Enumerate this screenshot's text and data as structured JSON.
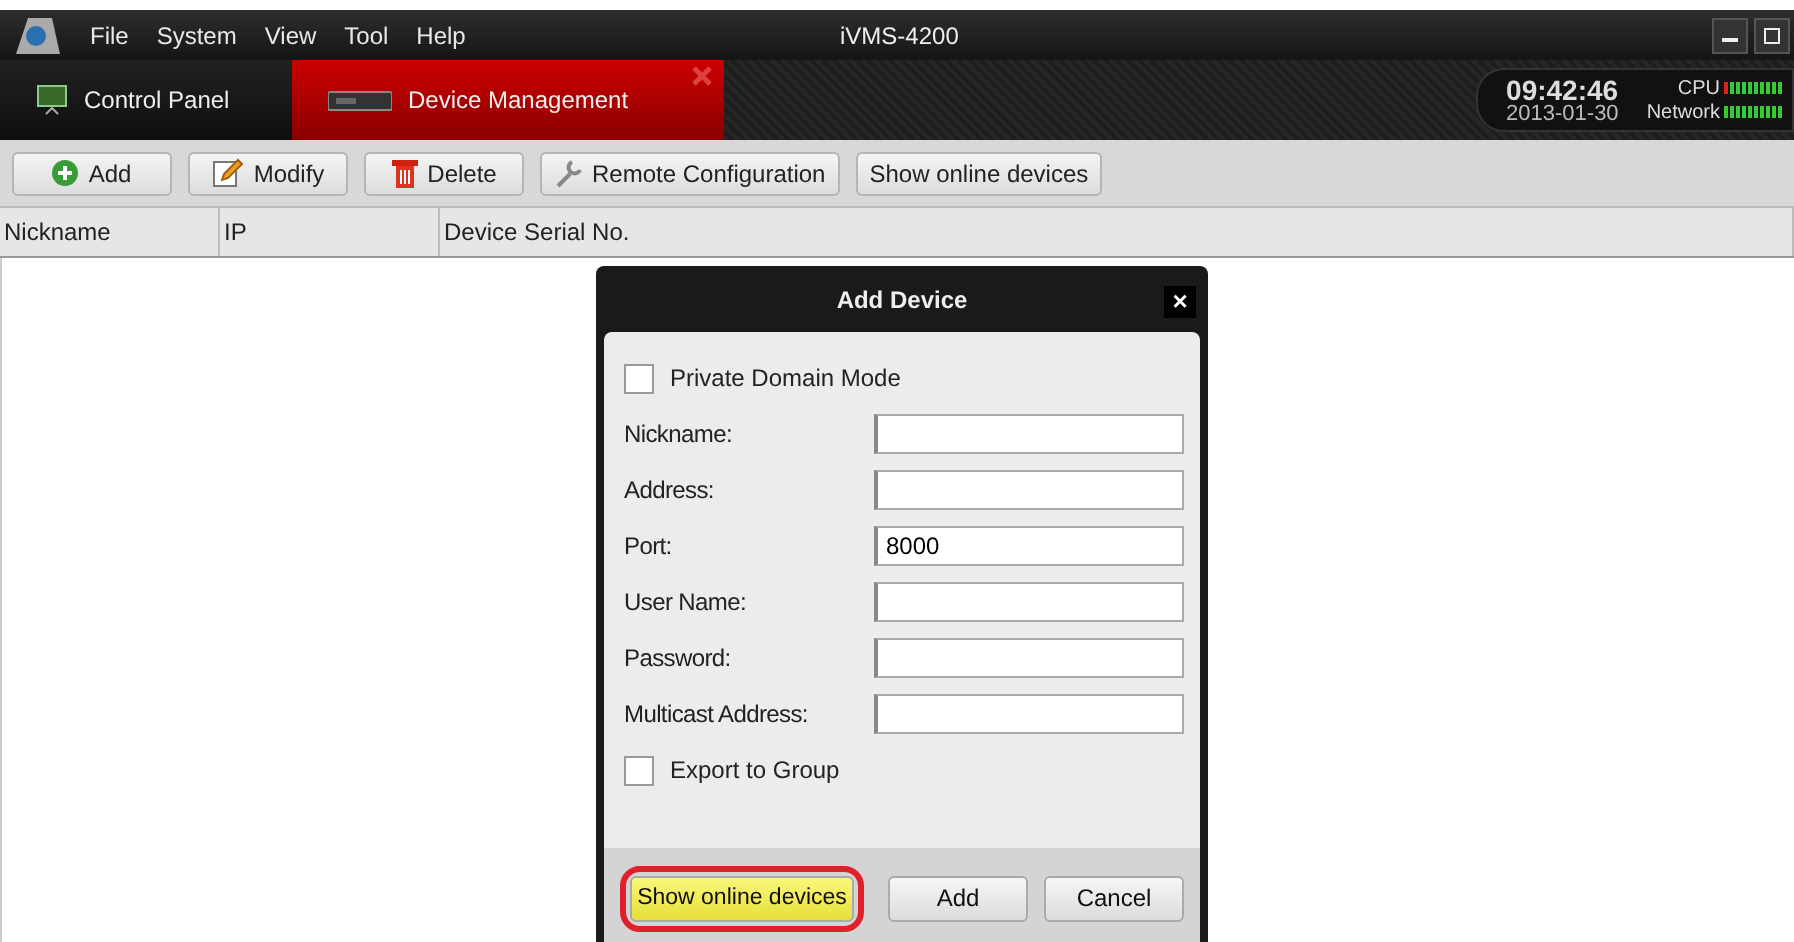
{
  "window": {
    "title": "iVMS-4200",
    "menu": [
      "File",
      "System",
      "View",
      "Tool",
      "Help"
    ]
  },
  "tabs": [
    {
      "label": "Control Panel",
      "selected": false,
      "kind": "panel"
    },
    {
      "label": "Device Management",
      "selected": true,
      "kind": "device"
    }
  ],
  "clock": {
    "time": "09:42:46",
    "date": "2013-01-30",
    "meters": [
      {
        "label": "CPU"
      },
      {
        "label": "Network"
      }
    ]
  },
  "toolbar": [
    {
      "label": "Add",
      "kind": "add"
    },
    {
      "label": "Modify",
      "kind": "modify"
    },
    {
      "label": "Delete",
      "kind": "delete"
    },
    {
      "label": "Remote Configuration",
      "kind": "remote"
    },
    {
      "label": "Show online devices",
      "kind": "plain"
    }
  ],
  "table": {
    "columns": [
      "Nickname",
      "IP",
      "Device Serial No."
    ]
  },
  "dialog": {
    "title": "Add Device",
    "close": "×",
    "checkboxes": [
      {
        "label": "Private Domain Mode",
        "checked": false
      },
      {
        "label": "Export to Group",
        "checked": false
      }
    ],
    "fields": [
      {
        "label": "Nickname:"
      },
      {
        "label": "Address:"
      },
      {
        "label": "Port:",
        "value": "8000"
      },
      {
        "label": "User Name:"
      },
      {
        "label": "Password:"
      },
      {
        "label": "Multicast Address:"
      }
    ],
    "buttons": [
      {
        "label": "Show online devices",
        "highlighted": true
      },
      {
        "label": "Add",
        "highlighted": false
      },
      {
        "label": "Cancel",
        "highlighted": false
      }
    ]
  }
}
